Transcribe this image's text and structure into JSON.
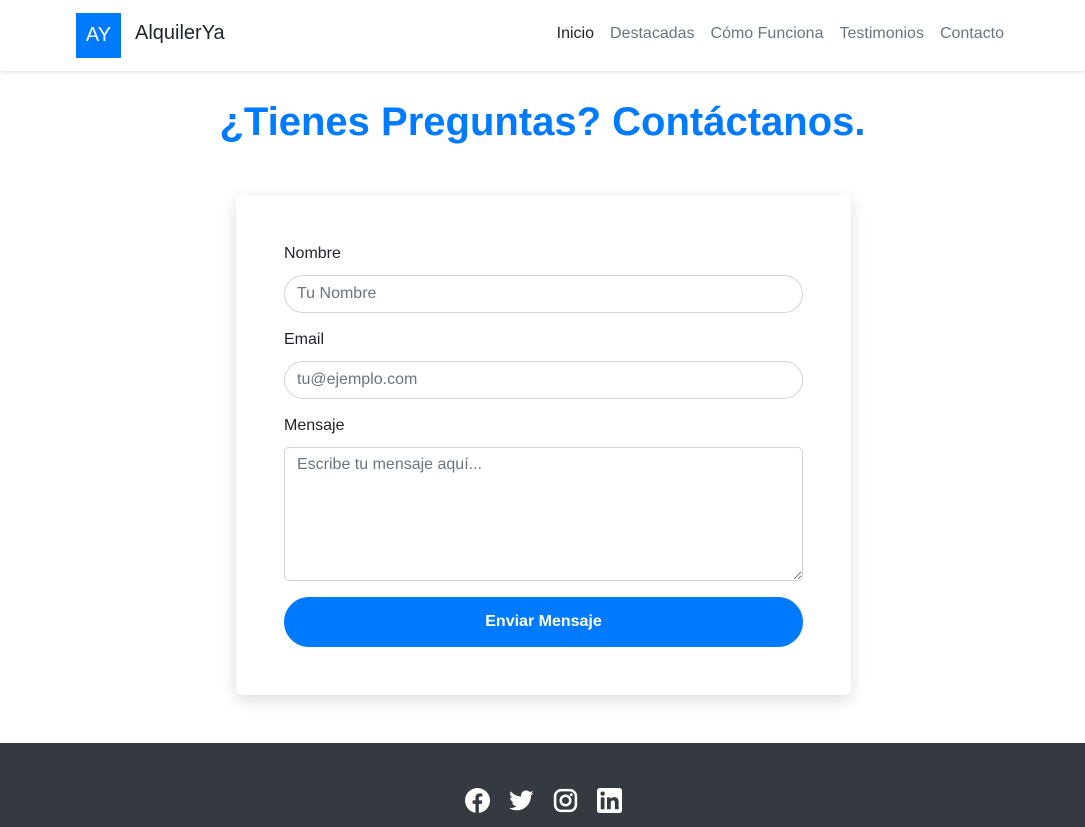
{
  "navbar": {
    "logo_text": "AY",
    "brand_name": "AlquilerYa",
    "links": [
      {
        "label": "Inicio",
        "active": true
      },
      {
        "label": "Destacadas",
        "active": false
      },
      {
        "label": "Cómo Funciona",
        "active": false
      },
      {
        "label": "Testimonios",
        "active": false
      },
      {
        "label": "Contacto",
        "active": false
      }
    ]
  },
  "page": {
    "title": "¿Tienes Preguntas? Contáctanos."
  },
  "form": {
    "name_label": "Nombre",
    "name_placeholder": "Tu Nombre",
    "email_label": "Email",
    "email_placeholder": "tu@ejemplo.com",
    "message_label": "Mensaje",
    "message_placeholder": "Escribe tu mensaje aquí...",
    "submit_label": "Enviar Mensaje"
  },
  "footer": {
    "social_icons": [
      "facebook-icon",
      "twitter-icon",
      "instagram-icon",
      "linkedin-icon"
    ]
  },
  "colors": {
    "accent": "#007bff",
    "footer_bg": "#343a40",
    "nav_text": "#6c757d",
    "nav_active": "#212529"
  }
}
